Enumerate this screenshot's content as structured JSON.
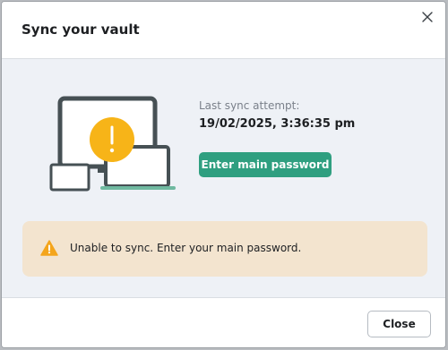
{
  "dialog": {
    "title": "Sync your vault",
    "close_icon": "close-icon"
  },
  "sync": {
    "label": "Last sync attempt:",
    "timestamp": "19/02/2025, 3:36:35 pm",
    "button_label": "Enter main password",
    "illustration_icon": "devices-warning-illustration"
  },
  "warning": {
    "icon": "warning-triangle-icon",
    "message": "Unable to sync. Enter your main password."
  },
  "footer": {
    "close_label": "Close"
  },
  "colors": {
    "accent": "#2f9f80",
    "warning_bg": "#f3e4cf",
    "warning_icon": "#f4a51c",
    "alert_circle": "#f7b418",
    "body_bg": "#eef1f6",
    "device_stroke": "#465054"
  }
}
